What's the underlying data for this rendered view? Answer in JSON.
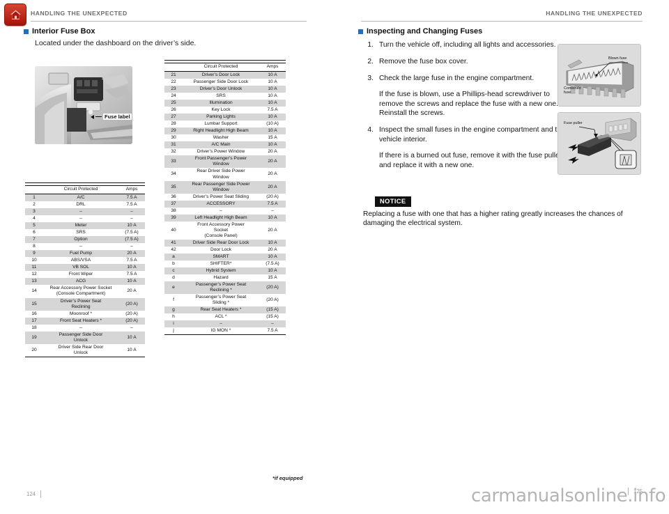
{
  "header": {
    "running_head_left": "HANDLING THE UNEXPECTED",
    "running_head_right": "HANDLING THE UNEXPECTED",
    "home_icon": "home-icon"
  },
  "left_page": {
    "section_title": "Interior Fuse Box",
    "lead_text": "Located under the dashboard on the driver’s side.",
    "photo_callout": "Fuse label",
    "folio": "124"
  },
  "table_headers": {
    "number": "",
    "circuit": "Circuit Protected",
    "amps": "Amps"
  },
  "fuse_table_left": [
    {
      "no": "1",
      "circuit": "A/C",
      "amps": "7.5 A"
    },
    {
      "no": "2",
      "circuit": "DRL",
      "amps": "7.5 A"
    },
    {
      "no": "3",
      "circuit": "–",
      "amps": "–"
    },
    {
      "no": "4",
      "circuit": "–",
      "amps": "–"
    },
    {
      "no": "5",
      "circuit": "Meter",
      "amps": "10 A"
    },
    {
      "no": "6",
      "circuit": "SRS",
      "amps": "(7.5 A)"
    },
    {
      "no": "7",
      "circuit": "Option",
      "amps": "(7.5 A)"
    },
    {
      "no": "8",
      "circuit": "–",
      "amps": "–"
    },
    {
      "no": "9",
      "circuit": "Fuel Pump",
      "amps": "20 A"
    },
    {
      "no": "10",
      "circuit": "ABS/VSA",
      "amps": "7.5 A"
    },
    {
      "no": "11",
      "circuit": "VB SOL",
      "amps": "10 A"
    },
    {
      "no": "12",
      "circuit": "Front Wiper",
      "amps": "7.5 A"
    },
    {
      "no": "13",
      "circuit": "ACG",
      "amps": "10 A"
    },
    {
      "no": "14",
      "circuit": "Rear Accessory Power Socket\n(Console Compartment)",
      "amps": "20 A"
    },
    {
      "no": "15",
      "circuit": "Driver’s Power Seat\nReclining",
      "amps": "(20 A)"
    },
    {
      "no": "16",
      "circuit": "Moonroof *",
      "amps": "(20 A)"
    },
    {
      "no": "17",
      "circuit": "Front Seat Heaters *",
      "amps": "(20 A)"
    },
    {
      "no": "18",
      "circuit": "–",
      "amps": "–"
    },
    {
      "no": "19",
      "circuit": "Passenger Side Door\nUnlock",
      "amps": "10 A"
    },
    {
      "no": "20",
      "circuit": "Driver Side Rear Door\nUnlock",
      "amps": "10 A"
    }
  ],
  "fuse_table_right": [
    {
      "no": "21",
      "circuit": "Driver’s Door Lock",
      "amps": "10 A"
    },
    {
      "no": "22",
      "circuit": "Passenger Side Door Lock",
      "amps": "10 A"
    },
    {
      "no": "23",
      "circuit": "Driver’s Door Unlock",
      "amps": "10 A"
    },
    {
      "no": "24",
      "circuit": "SRS",
      "amps": "10 A"
    },
    {
      "no": "25",
      "circuit": "Illumination",
      "amps": "10 A"
    },
    {
      "no": "26",
      "circuit": "Key Lock",
      "amps": "7.5 A"
    },
    {
      "no": "27",
      "circuit": "Parking Lights",
      "amps": "10 A"
    },
    {
      "no": "28",
      "circuit": "Lumbar Support",
      "amps": "(10 A)"
    },
    {
      "no": "29",
      "circuit": "Right Headlight High Beam",
      "amps": "10 A"
    },
    {
      "no": "30",
      "circuit": "Washer",
      "amps": "15 A"
    },
    {
      "no": "31",
      "circuit": "A/C Main",
      "amps": "10 A"
    },
    {
      "no": "32",
      "circuit": "Driver’s Power Window",
      "amps": "20 A"
    },
    {
      "no": "33",
      "circuit": "Front Passenger’s Power\nWindow",
      "amps": "20 A"
    },
    {
      "no": "34",
      "circuit": "Rear Driver Side Power\nWindow",
      "amps": "20 A"
    },
    {
      "no": "35",
      "circuit": "Rear Passenger Side Power\nWindow",
      "amps": "20 A"
    },
    {
      "no": "36",
      "circuit": "Driver’s Power Seat Sliding",
      "amps": "(20 A)"
    },
    {
      "no": "37",
      "circuit": "ACCESSORY",
      "amps": "7.5 A"
    },
    {
      "no": "38",
      "circuit": "–",
      "amps": "–"
    },
    {
      "no": "39",
      "circuit": "Left Headlight High Beam",
      "amps": "10 A"
    },
    {
      "no": "40",
      "circuit": "Front Accessory Power\nSocket\n(Console Panel)",
      "amps": "20 A"
    },
    {
      "no": "41",
      "circuit": "Driver Side Rear Door Lock",
      "amps": "10 A"
    },
    {
      "no": "42",
      "circuit": "Door Lock",
      "amps": "20 A"
    },
    {
      "no": "a",
      "circuit": "SMART",
      "amps": "10 A"
    },
    {
      "no": "b",
      "circuit": "SHIFTER*",
      "amps": "(7.5 A)"
    },
    {
      "no": "c",
      "circuit": "Hybrid System",
      "amps": "10 A"
    },
    {
      "no": "d",
      "circuit": "Hazard",
      "amps": "15 A"
    },
    {
      "no": "e",
      "circuit": "Passenger’s Power Seat\nReclining *",
      "amps": "(20 A)"
    },
    {
      "no": "f",
      "circuit": "Passenger’s Power Seat\nSliding *",
      "amps": "(20 A)"
    },
    {
      "no": "g",
      "circuit": "Rear Seat Heaters *",
      "amps": "(15 A)"
    },
    {
      "no": "h",
      "circuit": "ACL *",
      "amps": "(15 A)"
    },
    {
      "no": "i",
      "circuit": "–",
      "amps": "–"
    },
    {
      "no": "j",
      "circuit": "IG MON *",
      "amps": "7.5 A"
    }
  ],
  "footnote": "*if equipped",
  "right_page": {
    "section_title": "Inspecting and Changing Fuses",
    "steps": [
      {
        "num": "1.",
        "paras": [
          "Turn the vehicle off, including all lights and accessories."
        ]
      },
      {
        "num": "2.",
        "paras": [
          "Remove the fuse box cover."
        ]
      },
      {
        "num": "3.",
        "paras": [
          "Check the large fuse in the engine compartment.",
          "If the fuse is blown, use a Phillips-head screwdriver to remove the screws and replace the fuse with a new one. Reinstall the screws."
        ]
      },
      {
        "num": "4.",
        "paras": [
          "Inspect the small fuses in the engine compartment and the vehicle interior.",
          "If there is a burned out fuse, remove it with the fuse puller and replace it with a new one."
        ]
      }
    ],
    "image_one": {
      "label_top": "Blown fuse",
      "label_bottom": "Combined\nfuse"
    },
    "image_two": {
      "label": "Fuse puller"
    },
    "notice_label": "NOTICE",
    "notice_text": "Replacing a fuse with one that has a higher rating greatly increases the chances of damaging the electrical system.",
    "folio": "125"
  },
  "watermark": "carmanualsonline.info",
  "colors": {
    "accent_blue": "#2b6cb6",
    "home_red": "#c02a18",
    "row_shade": "#d6d6d6",
    "rule_gray": "#b9b9b9",
    "folio_gray": "#9a9a9a",
    "watermark_gray": "#b4b4b4"
  }
}
